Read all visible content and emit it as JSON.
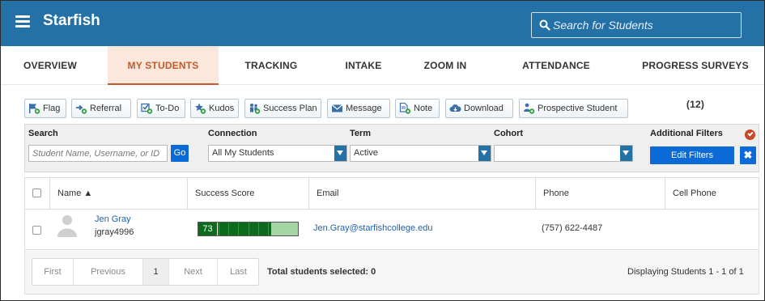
{
  "header": {
    "app_name": "Starfish",
    "search_placeholder": "Search for Students"
  },
  "tabs": [
    {
      "label": "OVERVIEW"
    },
    {
      "label": "MY STUDENTS",
      "active": true
    },
    {
      "label": "TRACKING"
    },
    {
      "label": "INTAKE"
    },
    {
      "label": "ZOOM IN"
    },
    {
      "label": "ATTENDANCE"
    },
    {
      "label": "PROGRESS SURVEYS (12)"
    }
  ],
  "actions": [
    {
      "label": "Flag",
      "icon": "flag-plus-icon"
    },
    {
      "label": "Referral",
      "icon": "referral-plus-icon"
    },
    {
      "label": "To-Do",
      "icon": "todo-plus-icon"
    },
    {
      "label": "Kudos",
      "icon": "kudos-star-icon"
    },
    {
      "label": "Success Plan",
      "icon": "success-plan-icon"
    },
    {
      "label": "Message",
      "icon": "envelope-icon"
    },
    {
      "label": "Note",
      "icon": "note-plus-icon"
    },
    {
      "label": "Download",
      "icon": "cloud-download-icon"
    },
    {
      "label": "Prospective Student",
      "icon": "prospective-student-icon"
    }
  ],
  "filters": {
    "search_label": "Search",
    "search_placeholder": "Student Name, Username, or ID",
    "go_label": "Go",
    "connection_label": "Connection",
    "connection_value": "All My Students",
    "term_label": "Term",
    "term_value": "Active",
    "cohort_label": "Cohort",
    "cohort_value": "",
    "additional_label": "Additional Filters",
    "edit_filters_label": "Edit Filters",
    "clear_label": "✖"
  },
  "table": {
    "columns": [
      "Name ▲",
      "Success Score",
      "Email",
      "Phone",
      "Cell Phone"
    ],
    "rows": [
      {
        "name": "Jen Gray",
        "username": "jgray4996",
        "success_score": "73",
        "success_score_fraction": 0.73,
        "email": "Jen.Gray@starfishcollege.edu",
        "phone": "(757) 622-4487",
        "cell_phone": ""
      }
    ]
  },
  "pager": {
    "first": "First",
    "previous": "Previous",
    "current": "1",
    "next": "Next",
    "last": "Last"
  },
  "footer": {
    "total_selected": "Total students selected: 0",
    "displaying": "Displaying Students 1 - 1 of 1"
  },
  "colors": {
    "header_blue": "#2471a7",
    "active_tab": "#c65a2b",
    "button_blue": "#0b6ad6",
    "score_dark_green": "#0e6b1e",
    "score_light_green": "#a5d4a5"
  }
}
